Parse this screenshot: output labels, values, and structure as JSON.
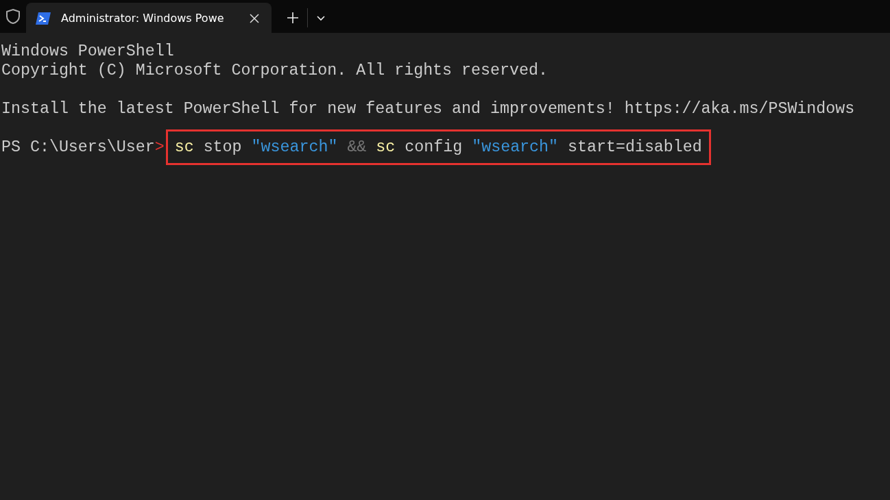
{
  "tab": {
    "title": "Administrator: Windows Powe",
    "selected": true
  },
  "console": {
    "blocks": [
      [
        "Windows PowerShell",
        "Copyright (C) Microsoft Corporation. All rights reserved."
      ],
      [
        "Install the latest PowerShell for new features and improvements! https://aka.ms/PSWindows"
      ]
    ],
    "prompt": {
      "path": "PS C:\\Users\\User",
      "symbol": ">"
    },
    "command": {
      "highlighted": true,
      "tokens": [
        {
          "kind": "command",
          "text": "sc"
        },
        {
          "kind": "argument",
          "text": "stop"
        },
        {
          "kind": "string",
          "text": "\"wsearch\""
        },
        {
          "kind": "operator",
          "text": "&&"
        },
        {
          "kind": "command",
          "text": "sc"
        },
        {
          "kind": "argument",
          "text": "config"
        },
        {
          "kind": "string",
          "text": "\"wsearch\""
        },
        {
          "kind": "argument",
          "text": "start=disabled"
        }
      ]
    }
  }
}
